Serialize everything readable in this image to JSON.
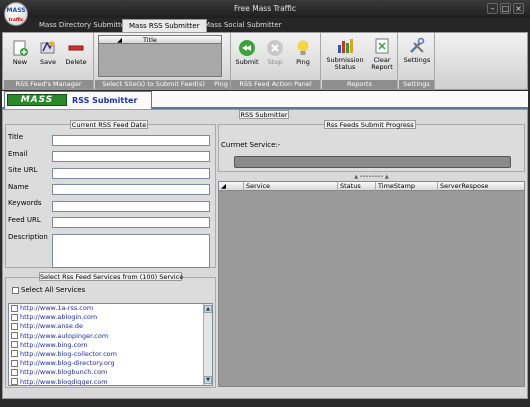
{
  "window": {
    "title": "Free Mass Traffic",
    "logo_text_top": "MASS",
    "logo_text_bottom": "traffic"
  },
  "tabs": [
    "Mass Directory Submitter",
    "Mass RSS Submitter",
    "Mass Social Submitter"
  ],
  "ribbon": {
    "groups": {
      "feeds_manager": "RSS Feed's Manager",
      "select_sites": "Select Site(s) to Submit Feed(s)",
      "ping": "Ping",
      "action_panel": "RSS Feed Action Panel",
      "reports": "Reports",
      "settings": "Settings"
    },
    "buttons": {
      "new": "New",
      "save": "Save",
      "delete": "Delete",
      "submit": "Submit",
      "stop": "Stop",
      "ping": "Ping",
      "submission_status_1": "Submission",
      "submission_status_2": "Status",
      "clear_report_1": "Clear",
      "clear_report_2": "Report",
      "settings": "Settings"
    },
    "site_grid_header": "Title"
  },
  "page": {
    "logo": "MASS",
    "title": "RSS Submitter",
    "section_label": "RSS Submitter"
  },
  "feed_form": {
    "section": "Current RSS Feed Date",
    "labels": {
      "title": "Title",
      "email": "Email",
      "site_url": "Site URL",
      "name": "Name",
      "keywords": "Keywords",
      "feed_url": "Feed URL",
      "description": "Description"
    }
  },
  "services": {
    "section": "Select Rss Feed Services from (100) Service",
    "select_all": "Select All Services",
    "items": [
      "http://www.1a-rss.com",
      "http://www.ablogin.com",
      "http://www.anse.de",
      "http://www.autopinger.com",
      "http://www.bing.com",
      "http://www.blog-collector.com",
      "http://www.blog-directory.org",
      "http://www.blogbunch.com",
      "http://www.blogdigger.com"
    ]
  },
  "progress": {
    "section": "Rss Feeds Submit Progress",
    "current_service_label": "Currnet Service:-",
    "splitter": "▲ •••••••• ▲",
    "columns": [
      "Service",
      "Status",
      "TimeStamp",
      "ServerRespose"
    ]
  },
  "colors": {
    "accent_blue": "#1d33b5",
    "link": "#1a2bb0",
    "mass_green": "#2a8a2a"
  }
}
